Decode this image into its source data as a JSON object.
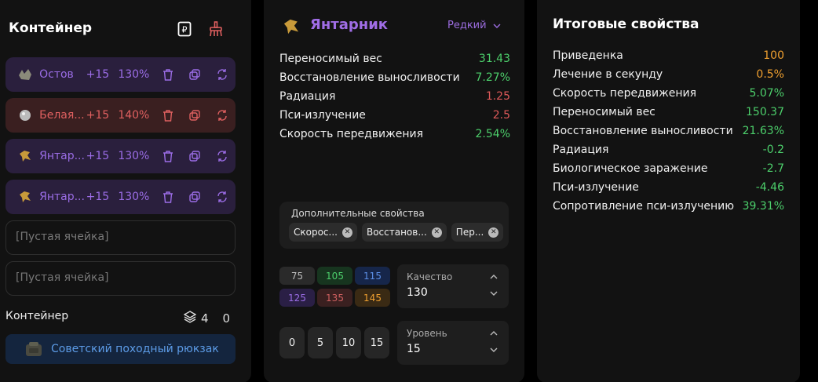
{
  "left": {
    "title": "Контейнер",
    "slots": [
      {
        "name": "Остов",
        "level": "+15",
        "pct": "130%",
        "variant": "purple"
      },
      {
        "name": "Белая...",
        "level": "+15",
        "pct": "140%",
        "variant": "red"
      },
      {
        "name": "Янтар...",
        "level": "+15",
        "pct": "130%",
        "variant": "purple"
      },
      {
        "name": "Янтар...",
        "level": "+15",
        "pct": "130%",
        "variant": "purple"
      }
    ],
    "empty1": "[Пустая ячейка]",
    "empty2": "[Пустая ячейка]",
    "container_label": "Контейнер",
    "layers_count": "4",
    "zero_count": "0",
    "backpack_label": "Советский походный рюкзак"
  },
  "mid": {
    "title": "Янтарник",
    "rarity": "Редкий",
    "stats": [
      {
        "label": "Переносимый вес",
        "value": "31.43",
        "color": "green"
      },
      {
        "label": "Восстановление выносливости",
        "value": "7.27%",
        "color": "green"
      },
      {
        "label": "Радиация",
        "value": "1.25",
        "color": "red"
      },
      {
        "label": "Пси-излучение",
        "value": "2.5",
        "color": "red"
      },
      {
        "label": "Скорость передвижения",
        "value": "2.54%",
        "color": "green"
      }
    ],
    "additional_label": "Дополнительные свойства",
    "chips": [
      "Скорос...",
      "Восстанов...",
      "Пер..."
    ],
    "quality_buttons": [
      {
        "label": "75",
        "bg": "#2a2a2a",
        "fg": "#bbbbbb"
      },
      {
        "label": "105",
        "bg": "#17351f",
        "fg": "#4ccf6b"
      },
      {
        "label": "115",
        "bg": "#16264a",
        "fg": "#5c8fe6"
      },
      {
        "label": "125",
        "bg": "#2a1f45",
        "fg": "#9b6de6"
      },
      {
        "label": "135",
        "bg": "#3a2020",
        "fg": "#d06060"
      },
      {
        "label": "145",
        "bg": "#3a2a14",
        "fg": "#f0a030"
      }
    ],
    "quality_label": "Качество",
    "quality_value": "130",
    "level_buttons": [
      "0",
      "5",
      "10",
      "15"
    ],
    "level_label": "Уровень",
    "level_value": "15"
  },
  "right": {
    "title": "Итоговые свойства",
    "stats": [
      {
        "label": "Приведенка",
        "value": "100",
        "color": "orange"
      },
      {
        "label": "Лечение в секунду",
        "value": "0.5%",
        "color": "orange"
      },
      {
        "label": "Скорость передвижения",
        "value": "5.07%",
        "color": "green"
      },
      {
        "label": "Переносимый вес",
        "value": "150.37",
        "color": "green"
      },
      {
        "label": "Восстановление выносливости",
        "value": "21.63%",
        "color": "green"
      },
      {
        "label": "Радиация",
        "value": "-0.2",
        "color": "green"
      },
      {
        "label": "Биологическое заражение",
        "value": "-2.7",
        "color": "green"
      },
      {
        "label": "Пси-излучение",
        "value": "-4.46",
        "color": "green"
      },
      {
        "label": "Сопротивление пси-излучению",
        "value": "39.31%",
        "color": "green"
      }
    ]
  }
}
